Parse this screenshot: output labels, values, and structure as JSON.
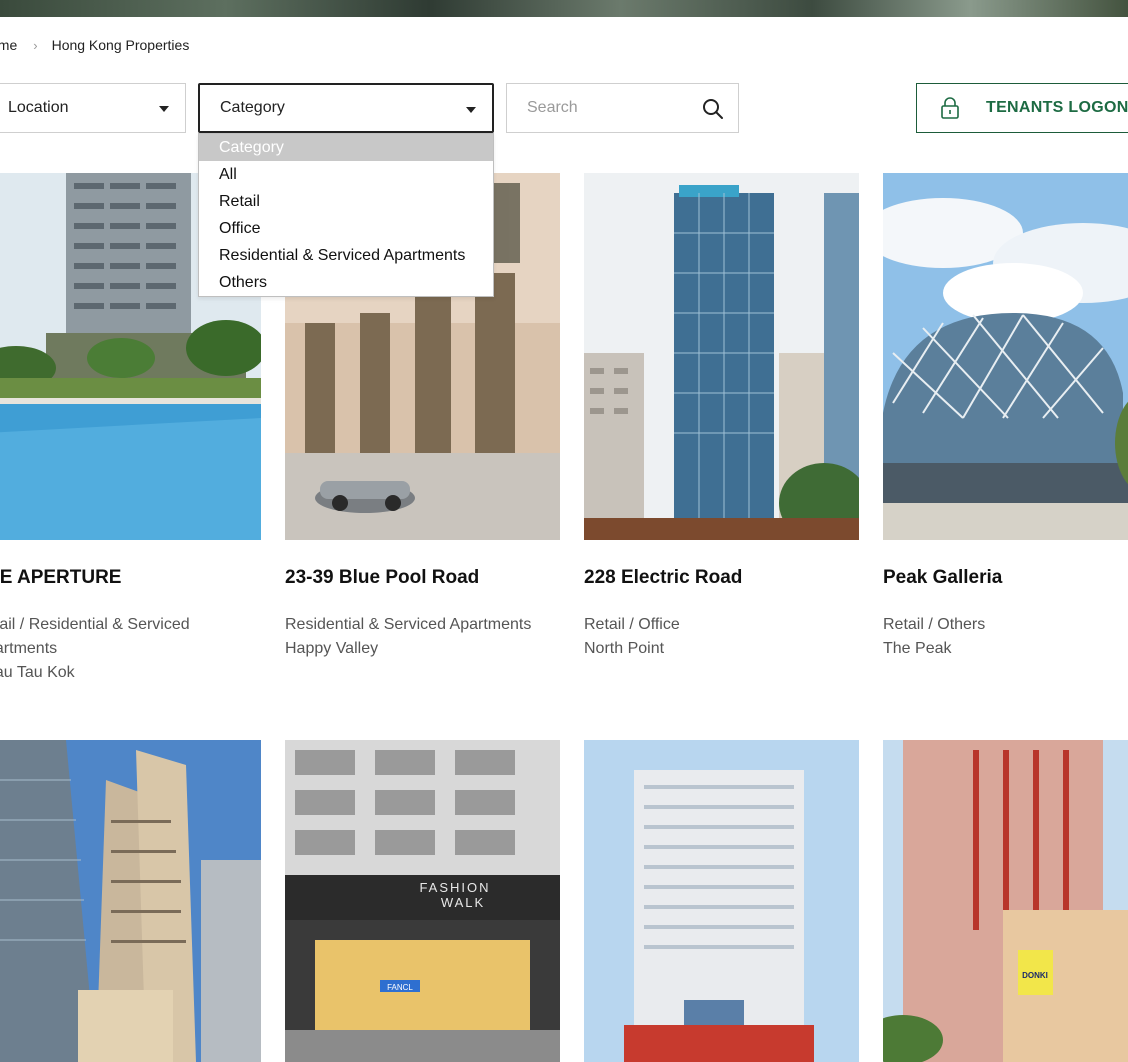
{
  "breadcrumb": {
    "home": "ome",
    "current": "Hong Kong Properties"
  },
  "filters": {
    "location_label": "Location",
    "category_label": "Category",
    "search_placeholder": "Search"
  },
  "tenants_button": {
    "label": "TENANTS LOGON"
  },
  "category_options": [
    "Category",
    "All",
    "Retail",
    "Office",
    "Residential & Serviced Apartments",
    "Others"
  ],
  "properties": [
    {
      "title": "HE APERTURE",
      "line1": "etail / Residential & Serviced",
      "line2": "partments",
      "line3": "gau Tau Kok"
    },
    {
      "title": "23-39 Blue Pool Road",
      "line1": "Residential & Serviced Apartments",
      "line2": "Happy Valley",
      "line3": ""
    },
    {
      "title": "228 Electric Road",
      "line1": "Retail / Office",
      "line2": "North Point",
      "line3": ""
    },
    {
      "title": "Peak Galleria",
      "line1": "Retail / Others",
      "line2": "The Peak",
      "line3": ""
    }
  ],
  "photo_signs": {
    "fashion_walk_line1": "FASHION",
    "fashion_walk_line2": "WALK",
    "fancl": "FANCL",
    "donki": "DONKI"
  },
  "colors": {
    "accent_green": "#1d6b43",
    "dropdown_selected": "#c8c8c8"
  },
  "icons": {
    "dropdown": "caret-down-icon",
    "search": "search-icon",
    "lock": "lock-icon",
    "breadcrumb_sep": "chevron-right-icon"
  }
}
